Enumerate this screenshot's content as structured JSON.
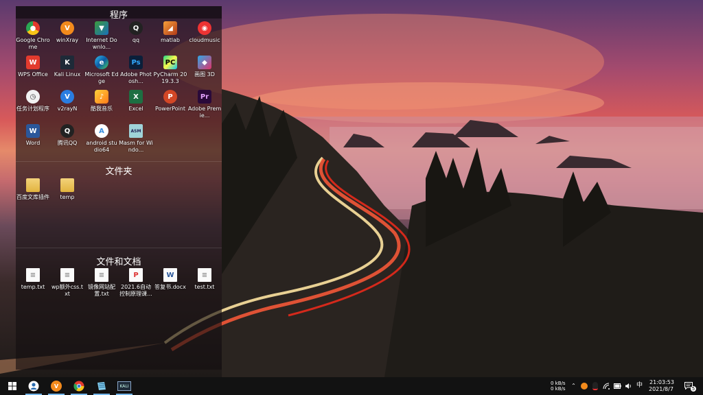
{
  "fences": {
    "programs": {
      "title": "程序",
      "items": [
        {
          "label": "Google Chrome",
          "icon": "chrome-icon"
        },
        {
          "label": "winXray",
          "icon": "winxray-icon"
        },
        {
          "label": "Internet Downlo...",
          "icon": "idm-icon"
        },
        {
          "label": "qq",
          "icon": "qq-icon"
        },
        {
          "label": "matlab",
          "icon": "matlab-icon"
        },
        {
          "label": "cloudmusic",
          "icon": "cloudmusic-icon"
        },
        {
          "label": "WPS Office",
          "icon": "wps-icon"
        },
        {
          "label": "Kali Linux",
          "icon": "kali-icon"
        },
        {
          "label": "Microsoft Edge",
          "icon": "edge-icon"
        },
        {
          "label": "Adobe Photosh...",
          "icon": "photoshop-icon"
        },
        {
          "label": "PyCharm 2019.3.3",
          "icon": "pycharm-icon"
        },
        {
          "label": "画图 3D",
          "icon": "paint3d-icon"
        },
        {
          "label": "任务计划程序",
          "icon": "task-scheduler-icon"
        },
        {
          "label": "v2rayN",
          "icon": "v2rayn-icon"
        },
        {
          "label": "酷我音乐",
          "icon": "kuwo-icon"
        },
        {
          "label": "Excel",
          "icon": "excel-icon"
        },
        {
          "label": "PowerPoint",
          "icon": "powerpoint-icon"
        },
        {
          "label": "Adobe Premie...",
          "icon": "premiere-icon"
        },
        {
          "label": "Word",
          "icon": "word-icon"
        },
        {
          "label": "腾讯QQ",
          "icon": "tencent-qq-icon"
        },
        {
          "label": "android studio64",
          "icon": "android-studio-icon"
        },
        {
          "label": "Masm for Windo...",
          "icon": "masm-icon"
        }
      ]
    },
    "folders": {
      "title": "文件夹",
      "items": [
        {
          "label": "百度文库插件",
          "icon": "folder-icon"
        },
        {
          "label": "temp",
          "icon": "folder-icon"
        }
      ]
    },
    "documents": {
      "title": "文件和文档",
      "items": [
        {
          "label": "temp.txt",
          "icon": "txt-file-icon"
        },
        {
          "label": "wp额外css.txt",
          "icon": "txt-file-icon"
        },
        {
          "label": "镜像网站配置.txt",
          "icon": "txt-file-icon"
        },
        {
          "label": "2021.6自动控制原理课...",
          "icon": "pdf-file-icon"
        },
        {
          "label": "答复书.docx",
          "icon": "docx-file-icon"
        },
        {
          "label": "test.txt",
          "icon": "txt-file-icon"
        }
      ]
    }
  },
  "taskbar": {
    "apps": [
      {
        "name": "start",
        "icon": "windows-start-icon"
      },
      {
        "name": "user",
        "icon": "user-icon"
      },
      {
        "name": "winxray",
        "icon": "winxray-icon"
      },
      {
        "name": "chrome",
        "icon": "chrome-icon"
      },
      {
        "name": "explorer",
        "icon": "notepad-icon"
      },
      {
        "name": "kali",
        "icon": "kali-icon"
      }
    ],
    "tray": {
      "net_up": "0 kB/s",
      "net_down": "0 kB/s",
      "ime": "中",
      "time": "21:03:53",
      "date": "2021/8/7",
      "notification_count": "5"
    }
  }
}
